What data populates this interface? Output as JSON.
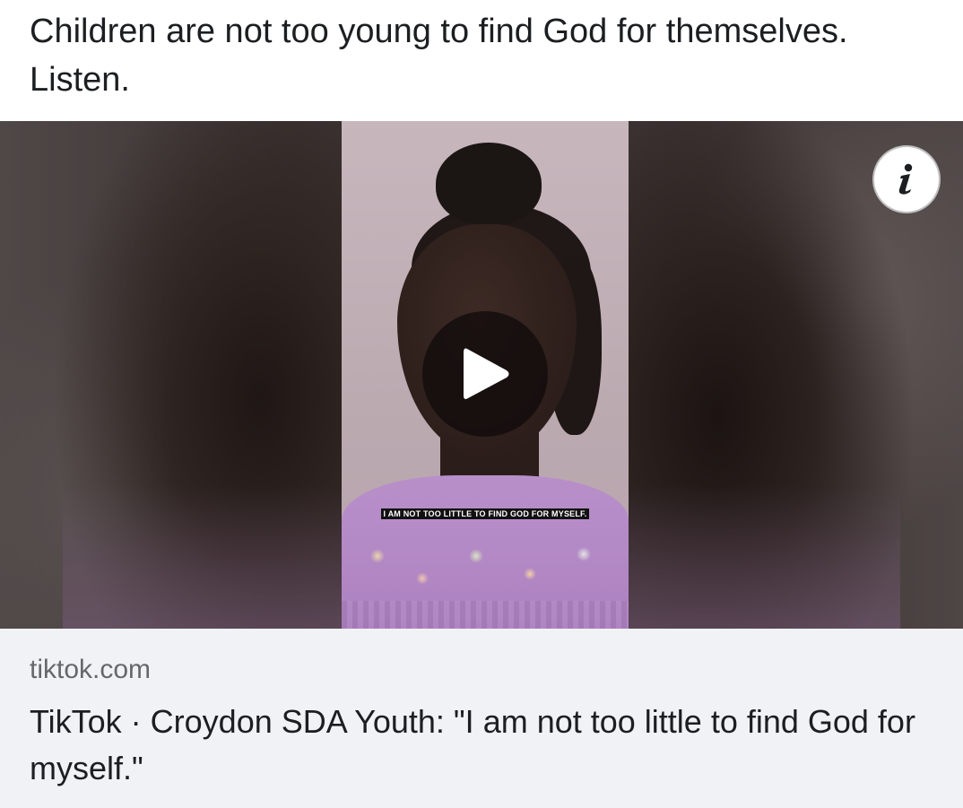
{
  "post": {
    "text": "Children are not too young to find God for themselves. Listen."
  },
  "video": {
    "caption": "I AM NOT TOO LITTLE TO FIND GOD FOR MYSELF.",
    "play_icon": "play-icon",
    "info_icon": "info-icon"
  },
  "link_preview": {
    "domain": "tiktok.com",
    "title": "TikTok · Croydon SDA Youth: \"I am not too little to find God for myself.\""
  },
  "colors": {
    "text_primary": "#1c1e21",
    "text_secondary": "#65676b",
    "link_background": "#f0f2f5"
  }
}
